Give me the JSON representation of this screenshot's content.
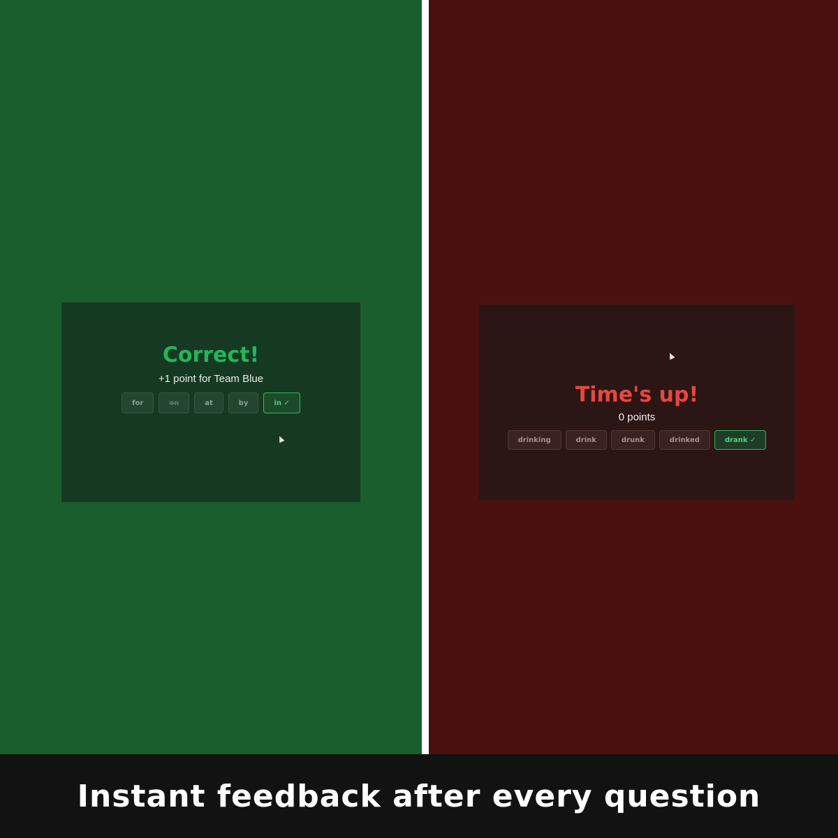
{
  "left_panel": {
    "headline": "Correct!",
    "subline": "+1 point for Team Blue",
    "options": [
      {
        "label": "for",
        "state": "default"
      },
      {
        "label": "on",
        "state": "eliminated"
      },
      {
        "label": "at",
        "state": "default"
      },
      {
        "label": "by",
        "state": "default"
      },
      {
        "label": "in ✓",
        "state": "correct"
      }
    ],
    "colors": {
      "background": "#1b5e2e",
      "headline": "#26b45c",
      "correct": "#2fb860"
    }
  },
  "right_panel": {
    "headline": "Time's up!",
    "subline": "0 points",
    "options": [
      {
        "label": "drinking",
        "state": "default"
      },
      {
        "label": "drink",
        "state": "default"
      },
      {
        "label": "drunk",
        "state": "default"
      },
      {
        "label": "drinked",
        "state": "default"
      },
      {
        "label": "drank ✓",
        "state": "correct"
      }
    ],
    "colors": {
      "background": "#4a1010",
      "headline": "#e5483e",
      "correct": "#2fb860"
    }
  },
  "caption": {
    "text": "Instant feedback after every question"
  }
}
